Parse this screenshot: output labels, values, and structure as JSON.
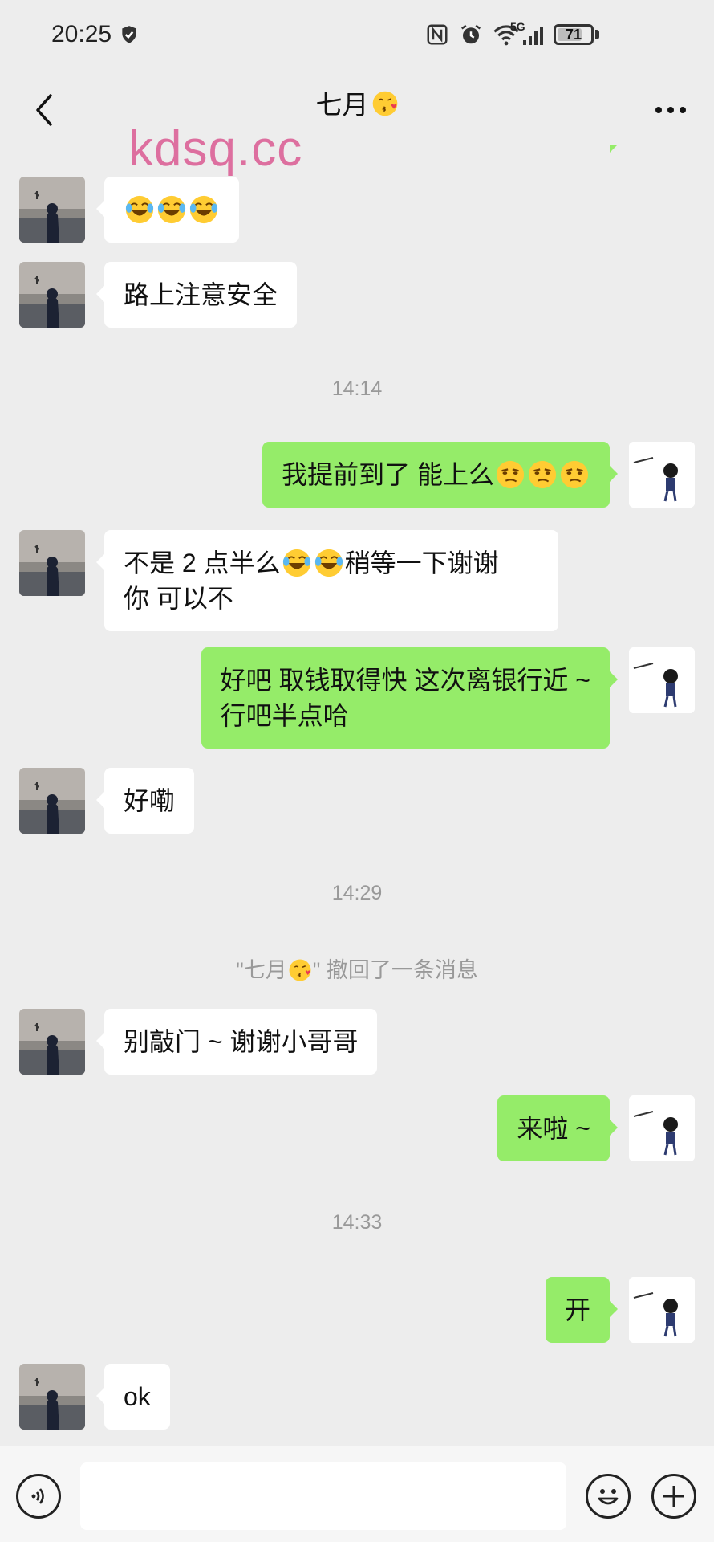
{
  "status_bar": {
    "time": "20:25",
    "network": "5G",
    "battery": "71"
  },
  "header": {
    "title": "七月",
    "title_emoji": "kissing-face-emoji",
    "back_icon": "chevron-left-icon",
    "more_icon": "more-dots-icon"
  },
  "watermark": "kdsq.cc",
  "messages": {
    "m1": {
      "side": "left",
      "emojis": [
        "laughing-tears-emoji",
        "laughing-tears-emoji",
        "laughing-tears-emoji"
      ]
    },
    "m2": {
      "side": "left",
      "text": "路上注意安全"
    },
    "t1": "14:14",
    "m3": {
      "side": "right",
      "text": "我提前到了 能上么",
      "emojis": [
        "smirk-face-emoji",
        "smirk-face-emoji",
        "smirk-face-emoji"
      ]
    },
    "m4": {
      "side": "left",
      "text_a": "不是 2 点半么",
      "text_b": "稍等一下谢谢",
      "text_c": "你 可以不"
    },
    "m5": {
      "side": "right",
      "line1": "好吧 取钱取得快 这次离银行近 ~",
      "line2": "行吧半点哈"
    },
    "m6": {
      "side": "left",
      "text": "好嘞"
    },
    "t2": "14:29",
    "recall": {
      "name": "\"七月",
      "suffix": "\" 撤回了一条消息"
    },
    "m7": {
      "side": "left",
      "text": "别敲门 ~ 谢谢小哥哥"
    },
    "m8": {
      "side": "right",
      "text": "来啦 ~"
    },
    "t3": "14:33",
    "m9": {
      "side": "right",
      "text": "开"
    },
    "m10": {
      "side": "left",
      "text": "ok"
    }
  },
  "input_bar": {
    "voice_icon": "voice-icon",
    "emoji_icon": "smiley-icon",
    "plus_icon": "plus-icon",
    "placeholder": ""
  },
  "colors": {
    "background": "#ededed",
    "bubble_self": "#95ec69",
    "bubble_other": "#ffffff",
    "watermark": "#dd6f9f",
    "meta_text": "#999999"
  }
}
